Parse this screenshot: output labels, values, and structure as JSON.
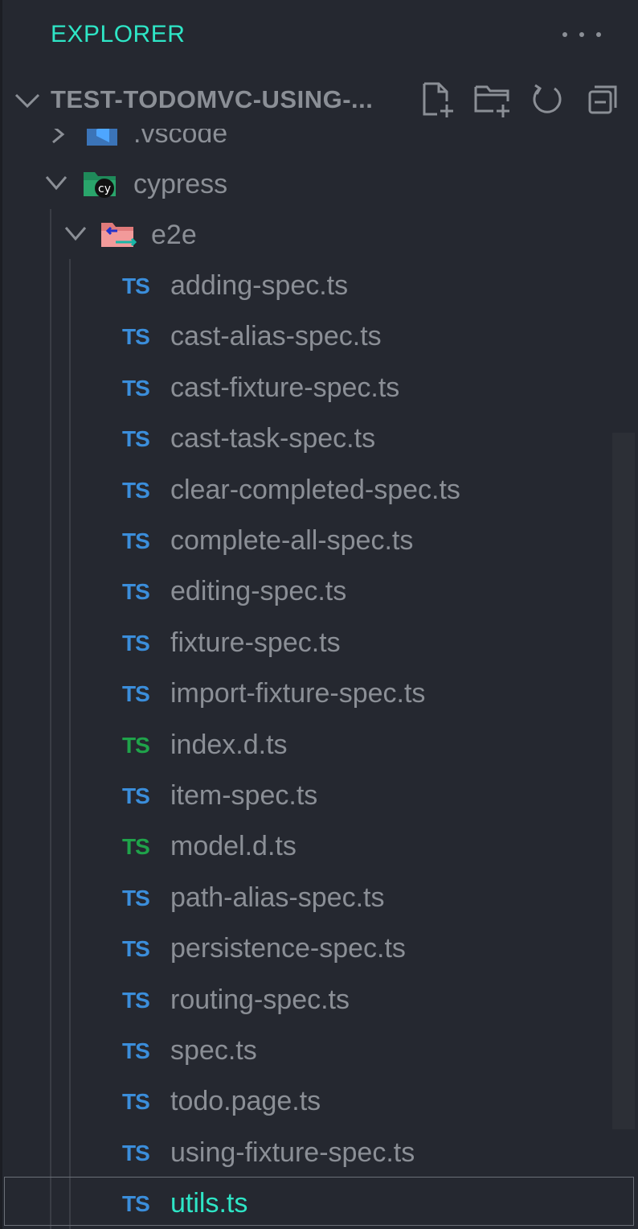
{
  "explorer": {
    "title": "EXPLORER"
  },
  "section": {
    "title": "TEST-TODOMVC-USING-...",
    "actions": [
      "new-file-icon",
      "new-folder-icon",
      "refresh-icon",
      "collapse-all-icon"
    ]
  },
  "tree": {
    "folders": {
      "vscode": ".vscode",
      "cypress": "cypress",
      "e2e": "e2e"
    },
    "file_badge": "TS",
    "files": [
      {
        "name": "adding-spec.ts",
        "badge_color": "#3b8edb"
      },
      {
        "name": "cast-alias-spec.ts",
        "badge_color": "#3b8edb"
      },
      {
        "name": "cast-fixture-spec.ts",
        "badge_color": "#3b8edb"
      },
      {
        "name": "cast-task-spec.ts",
        "badge_color": "#3b8edb"
      },
      {
        "name": "clear-completed-spec.ts",
        "badge_color": "#3b8edb"
      },
      {
        "name": "complete-all-spec.ts",
        "badge_color": "#3b8edb"
      },
      {
        "name": "editing-spec.ts",
        "badge_color": "#3b8edb"
      },
      {
        "name": "fixture-spec.ts",
        "badge_color": "#3b8edb"
      },
      {
        "name": "import-fixture-spec.ts",
        "badge_color": "#3b8edb"
      },
      {
        "name": "index.d.ts",
        "badge_color": "#1fa34a"
      },
      {
        "name": "item-spec.ts",
        "badge_color": "#3b8edb"
      },
      {
        "name": "model.d.ts",
        "badge_color": "#1fa34a"
      },
      {
        "name": "path-alias-spec.ts",
        "badge_color": "#3b8edb"
      },
      {
        "name": "persistence-spec.ts",
        "badge_color": "#3b8edb"
      },
      {
        "name": "routing-spec.ts",
        "badge_color": "#3b8edb"
      },
      {
        "name": "spec.ts",
        "badge_color": "#3b8edb"
      },
      {
        "name": "todo.page.ts",
        "badge_color": "#3b8edb"
      },
      {
        "name": "using-fixture-spec.ts",
        "badge_color": "#3b8edb"
      },
      {
        "name": "utils.ts",
        "badge_color": "#3b8edb",
        "selected": true
      }
    ]
  },
  "colors": {
    "background": "#252830",
    "accent": "#2ee6c6",
    "text": "#8b8f96",
    "ts_blue": "#3b8edb",
    "ts_green": "#1fa34a"
  }
}
